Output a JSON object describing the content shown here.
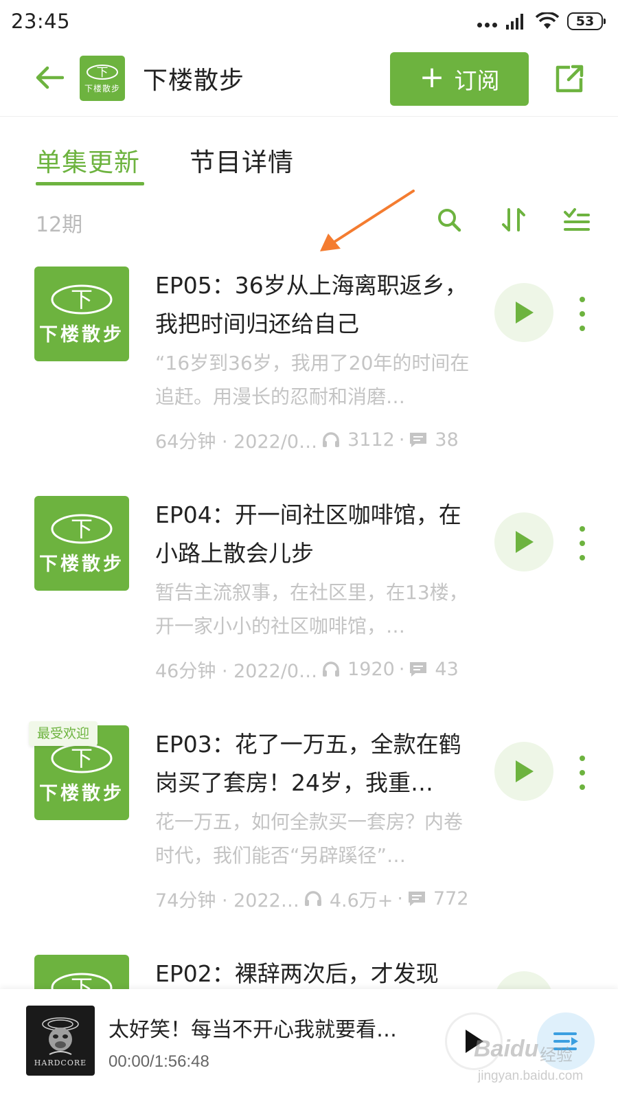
{
  "status_bar": {
    "time": "23:45",
    "battery": "53"
  },
  "header": {
    "podcast_title": "下楼散步",
    "subscribe_label": "订阅",
    "logo_text": "下楼散步",
    "logo_glyph": "下"
  },
  "tabs": [
    {
      "label": "单集更新",
      "active": true
    },
    {
      "label": "节目详情",
      "active": false
    }
  ],
  "episode_count": "12期",
  "accent_color": "#6db33f",
  "cover_text": "下楼散步",
  "cover_glyph": "下",
  "episodes": [
    {
      "title": "EP05：36岁从上海离职返乡，我把时间归还给自己",
      "description": "“16岁到36岁，我用了20年的时间在追赶。用漫长的忍耐和消磨…",
      "duration": "64分钟 · 2022/0…",
      "plays": "3112",
      "comments": "38",
      "badge": ""
    },
    {
      "title": "EP04：开一间社区咖啡馆，在小路上散会儿步",
      "description": "暂告主流叙事，在社区里，在13楼，开一家小小的社区咖啡馆，…",
      "duration": "46分钟 · 2022/0…",
      "plays": "1920",
      "comments": "43",
      "badge": ""
    },
    {
      "title": "EP03：花了一万五，全款在鹤岗买了套房！24岁，我重…",
      "description": "花一万五，如何全款买一套房？内卷时代，我们能否“另辟蹊径”…",
      "duration": "74分钟 · 2022…",
      "plays": "4.6万+",
      "comments": "772",
      "badge": "最受欢迎"
    },
    {
      "title": "EP02：裸辞两次后，才发现"
    }
  ],
  "mini_player": {
    "title": "太好笑！每当不开心我就要看…",
    "time": "00:00/1:56:48",
    "cover_text": "HARDCORE"
  },
  "watermark": {
    "brand": "Baidu",
    "jingyan": "经验",
    "url": "jingyan.baidu.com"
  },
  "icons": {
    "back": "arrow-left-icon",
    "share": "share-icon",
    "search": "search-icon",
    "sort": "sort-icon",
    "filter": "filter-icon",
    "play": "play-icon",
    "more": "more-icon",
    "headphones": "headphones-icon",
    "comment": "comment-icon",
    "playlist": "playlist-icon"
  }
}
